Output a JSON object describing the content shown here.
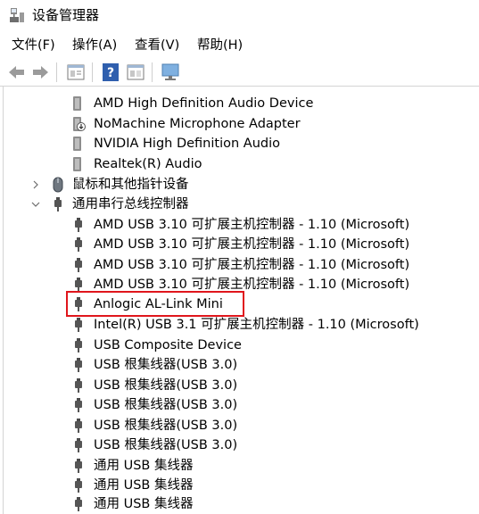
{
  "window": {
    "title": "设备管理器",
    "icon": "device-manager-icon"
  },
  "menu": [
    {
      "label": "文件(F)"
    },
    {
      "label": "操作(A)"
    },
    {
      "label": "查看(V)"
    },
    {
      "label": "帮助(H)"
    }
  ],
  "toolbar": [
    "back-arrow-icon",
    "forward-arrow-icon",
    "properties-icon",
    "help-icon",
    "view-icon",
    "monitor-icon"
  ],
  "tree": {
    "audio_devices": [
      {
        "label": "AMD High Definition Audio Device",
        "icon": "speaker-icon"
      },
      {
        "label": "NoMachine Microphone Adapter",
        "icon": "speaker-download-icon"
      },
      {
        "label": "NVIDIA High Definition Audio",
        "icon": "speaker-icon"
      },
      {
        "label": "Realtek(R) Audio",
        "icon": "speaker-icon"
      }
    ],
    "mice_category": {
      "label": "鼠标和其他指针设备",
      "icon": "mouse-icon",
      "expanded": false
    },
    "usb_category": {
      "label": "通用串行总线控制器",
      "icon": "usb-plug-icon",
      "expanded": true
    },
    "usb_devices": [
      {
        "label": "AMD USB 3.10 可扩展主机控制器 - 1.10 (Microsoft)"
      },
      {
        "label": "AMD USB 3.10 可扩展主机控制器 - 1.10 (Microsoft)"
      },
      {
        "label": "AMD USB 3.10 可扩展主机控制器 - 1.10 (Microsoft)"
      },
      {
        "label": "AMD USB 3.10 可扩展主机控制器 - 1.10 (Microsoft)"
      },
      {
        "label": "Anlogic AL-Link Mini",
        "highlighted": true
      },
      {
        "label": "Intel(R) USB 3.1 可扩展主机控制器 - 1.10 (Microsoft)"
      },
      {
        "label": "USB Composite Device"
      },
      {
        "label": "USB 根集线器(USB 3.0)"
      },
      {
        "label": "USB 根集线器(USB 3.0)"
      },
      {
        "label": "USB 根集线器(USB 3.0)"
      },
      {
        "label": "USB 根集线器(USB 3.0)"
      },
      {
        "label": "USB 根集线器(USB 3.0)"
      },
      {
        "label": "通用 USB 集线器"
      },
      {
        "label": "通用 USB 集线器"
      },
      {
        "label": "通用 USB 集线器"
      }
    ]
  },
  "colors": {
    "highlight_border": "#e0161c",
    "chevron": "#6b6b6b"
  }
}
